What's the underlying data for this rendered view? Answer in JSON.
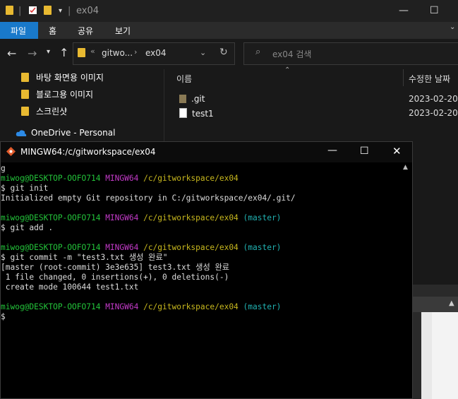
{
  "explorer": {
    "window_title": "ex04",
    "ribbon_tabs": [
      "파일",
      "홈",
      "공유",
      "보기"
    ],
    "breadcrumb": [
      "gitwo...",
      "ex04"
    ],
    "breadcrumb_overflow": "«",
    "search_placeholder": "ex04 검색",
    "nav_items": [
      {
        "label": "바탕 화면용 이미지",
        "icon": "folder-icon"
      },
      {
        "label": "블로그용 이미지",
        "icon": "folder-icon"
      },
      {
        "label": "스크린샷",
        "icon": "folder-icon"
      },
      {
        "label": "OneDrive - Personal",
        "icon": "cloud-icon"
      }
    ],
    "columns": {
      "name": "이름",
      "date": "수정한 날짜"
    },
    "files": [
      {
        "name": ".git",
        "date": "2023-02-20",
        "icon": "folder-icon"
      },
      {
        "name": "test1",
        "date": "2023-02-20",
        "icon": "file-icon"
      }
    ]
  },
  "terminal": {
    "title": "MINGW64:/c/gitworkspace/ex04",
    "lines": [
      {
        "parts": [
          {
            "t": "g",
            "c": ""
          }
        ]
      },
      {
        "parts": [
          {
            "t": "miwog@DESKTOP-OOFO714 ",
            "c": "g"
          },
          {
            "t": "MINGW64 ",
            "c": "m"
          },
          {
            "t": "/c/gitworkspace/ex04",
            "c": "y"
          }
        ]
      },
      {
        "parts": [
          {
            "t": "$ git init",
            "c": ""
          }
        ]
      },
      {
        "parts": [
          {
            "t": "Initialized empty Git repository in C:/gitworkspace/ex04/.git/",
            "c": ""
          }
        ]
      },
      {
        "parts": [
          {
            "t": "",
            "c": ""
          }
        ]
      },
      {
        "parts": [
          {
            "t": "miwog@DESKTOP-OOFO714 ",
            "c": "g"
          },
          {
            "t": "MINGW64 ",
            "c": "m"
          },
          {
            "t": "/c/gitworkspace/ex04",
            "c": "y"
          },
          {
            "t": " (master)",
            "c": "c"
          }
        ]
      },
      {
        "parts": [
          {
            "t": "$ git add .",
            "c": ""
          }
        ]
      },
      {
        "parts": [
          {
            "t": "",
            "c": ""
          }
        ]
      },
      {
        "parts": [
          {
            "t": "miwog@DESKTOP-OOFO714 ",
            "c": "g"
          },
          {
            "t": "MINGW64 ",
            "c": "m"
          },
          {
            "t": "/c/gitworkspace/ex04",
            "c": "y"
          },
          {
            "t": " (master)",
            "c": "c"
          }
        ]
      },
      {
        "parts": [
          {
            "t": "$ git commit -m \"test3.txt 생성 완료\"",
            "c": ""
          }
        ]
      },
      {
        "parts": [
          {
            "t": "[master (root-commit) 3e3e635] test3.txt 생성 완료",
            "c": ""
          }
        ]
      },
      {
        "parts": [
          {
            "t": " 1 file changed, 0 insertions(+), 0 deletions(-)",
            "c": ""
          }
        ]
      },
      {
        "parts": [
          {
            "t": " create mode 100644 test1.txt",
            "c": ""
          }
        ]
      },
      {
        "parts": [
          {
            "t": "",
            "c": ""
          }
        ]
      },
      {
        "parts": [
          {
            "t": "miwog@DESKTOP-OOFO714 ",
            "c": "g"
          },
          {
            "t": "MINGW64 ",
            "c": "m"
          },
          {
            "t": "/c/gitworkspace/ex04",
            "c": "y"
          },
          {
            "t": " (master)",
            "c": "c"
          }
        ]
      },
      {
        "parts": [
          {
            "t": "$",
            "c": ""
          }
        ]
      }
    ]
  },
  "colors": {
    "ribbon_active": "#1979ca",
    "prompt_user": "#23c43a",
    "prompt_env": "#c33ac8",
    "prompt_path": "#c8b81e",
    "prompt_branch": "#20b0b0"
  }
}
